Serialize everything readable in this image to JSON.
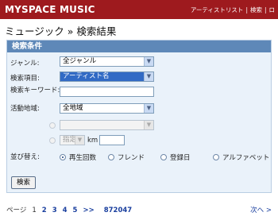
{
  "header": {
    "logo": "MYSPACE MUSIC",
    "links": [
      "アーティストリスト",
      "検索",
      "ロ"
    ]
  },
  "page_title": "ミュージック » 検索結果",
  "panel": {
    "title": "検索条件",
    "genre_label": "ジャンル:",
    "genre_value": "全ジャンル",
    "search_item_label": "検索項目:",
    "search_item_value": "アーティスト名",
    "keyword_label": "検索キーワード:",
    "keyword_value": "",
    "location_label": "活動地域:",
    "location_value": "全地域",
    "sub_location_value": "",
    "distance_select_value": "指定",
    "distance_unit": "km",
    "distance_value": "",
    "sort_label": "並び替え:",
    "sort_options": [
      "再生回数",
      "フレンド",
      "登録日",
      "アルファベット"
    ],
    "sort_selected": "再生回数",
    "search_button": "検索"
  },
  "pager": {
    "label": "ページ",
    "current": "1",
    "pages": [
      "2",
      "3",
      "4",
      "5"
    ],
    "more": ">>",
    "last": "872047",
    "next": "次へ >"
  }
}
